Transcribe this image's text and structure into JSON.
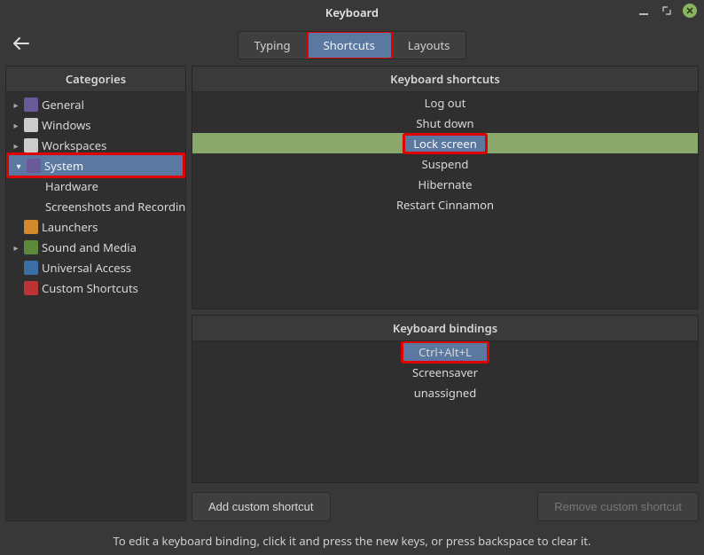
{
  "window": {
    "title": "Keyboard"
  },
  "tabs": {
    "items": [
      {
        "label": "Typing",
        "active": false
      },
      {
        "label": "Shortcuts",
        "active": true
      },
      {
        "label": "Layouts",
        "active": false
      }
    ]
  },
  "sidebar": {
    "title": "Categories",
    "items": [
      {
        "label": "General",
        "expandable": true,
        "expanded": false,
        "icon": "purple",
        "selected": false,
        "child": false
      },
      {
        "label": "Windows",
        "expandable": true,
        "expanded": false,
        "icon": "white",
        "selected": false,
        "child": false
      },
      {
        "label": "Workspaces",
        "expandable": true,
        "expanded": false,
        "icon": "white",
        "selected": false,
        "child": false
      },
      {
        "label": "System",
        "expandable": true,
        "expanded": true,
        "icon": "purple",
        "selected": true,
        "child": false,
        "highlight": true
      },
      {
        "label": "Hardware",
        "expandable": false,
        "expanded": false,
        "icon": "",
        "selected": false,
        "child": true
      },
      {
        "label": "Screenshots and Recording",
        "expandable": false,
        "expanded": false,
        "icon": "",
        "selected": false,
        "child": true
      },
      {
        "label": "Launchers",
        "expandable": false,
        "expanded": false,
        "icon": "orange",
        "selected": false,
        "child": false
      },
      {
        "label": "Sound and Media",
        "expandable": true,
        "expanded": false,
        "icon": "green",
        "selected": false,
        "child": false
      },
      {
        "label": "Universal Access",
        "expandable": false,
        "expanded": false,
        "icon": "blue",
        "selected": false,
        "child": false
      },
      {
        "label": "Custom Shortcuts",
        "expandable": false,
        "expanded": false,
        "icon": "red",
        "selected": false,
        "child": false
      }
    ]
  },
  "shortcuts": {
    "title": "Keyboard shortcuts",
    "items": [
      {
        "label": "Log out",
        "selected": false
      },
      {
        "label": "Shut down",
        "selected": false
      },
      {
        "label": "Lock screen",
        "selected": true,
        "highlight": true
      },
      {
        "label": "Suspend",
        "selected": false
      },
      {
        "label": "Hibernate",
        "selected": false
      },
      {
        "label": "Restart Cinnamon",
        "selected": false
      }
    ]
  },
  "bindings": {
    "title": "Keyboard bindings",
    "items": [
      {
        "label": "Ctrl+Alt+L",
        "selected": true,
        "highlight": true
      },
      {
        "label": "Screensaver",
        "selected": false
      },
      {
        "label": "unassigned",
        "selected": false
      }
    ]
  },
  "buttons": {
    "add": "Add custom shortcut",
    "remove": "Remove custom shortcut"
  },
  "hint": "To edit a keyboard binding, click it and press the new keys, or press backspace to clear it."
}
